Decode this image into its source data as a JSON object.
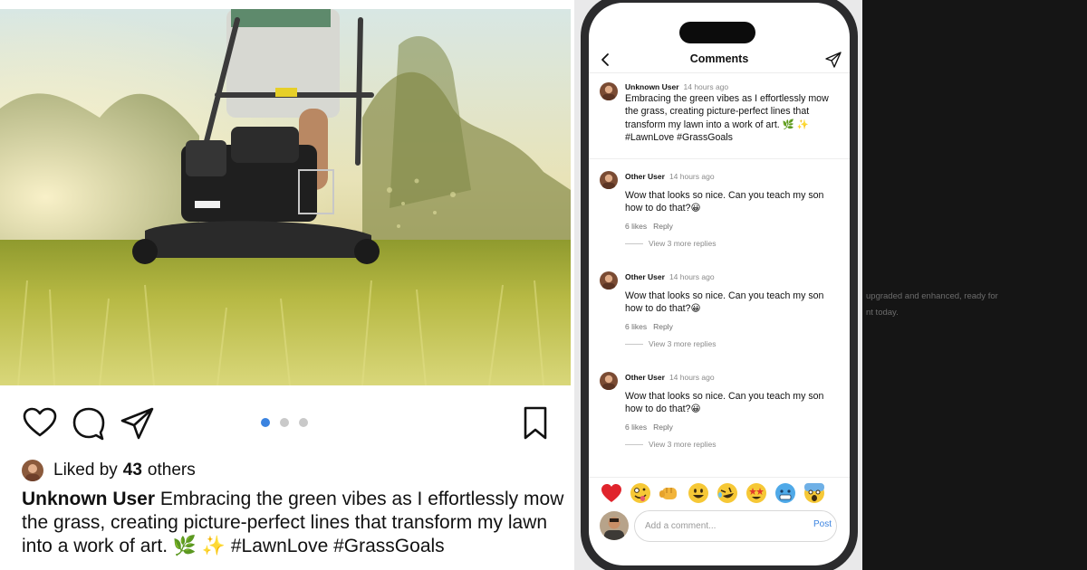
{
  "post": {
    "photo": {
      "description_icon": "lawn-mower-photo"
    },
    "actions": {
      "like_icon": "heart-icon",
      "comment_icon": "speech-bubble-icon",
      "share_icon": "paper-plane-icon",
      "save_icon": "bookmark-icon"
    },
    "carousel": {
      "count": 3,
      "active_index": 0
    },
    "likes": {
      "prefix": "Liked by",
      "count": "43",
      "suffix": "others"
    },
    "caption": {
      "user": "Unknown User",
      "text": "Embracing the green vibes as I effortlessly mow the grass, creating picture-perfect lines that transform my lawn into a work of art. 🌿 ✨ #LawnLove #GrassGoals"
    }
  },
  "phone": {
    "header": {
      "title": "Comments",
      "back_icon": "chevron-left-icon",
      "send_icon": "paper-plane-icon"
    },
    "original": {
      "user": "Unknown User",
      "time": "14 hours ago",
      "text": "Embracing the green vibes as I effortlessly mow the grass, creating picture-perfect lines that transform my lawn into a work of art. 🌿 ✨ #LawnLove #GrassGoals"
    },
    "comments": [
      {
        "user": "Other User",
        "time": "14 hours ago",
        "text": "Wow that looks so nice. Can you teach my son how to do that?😀",
        "likes": "6 likes",
        "reply": "Reply",
        "more": "View 3 more replies"
      },
      {
        "user": "Other User",
        "time": "14 hours ago",
        "text": "Wow that looks so nice. Can you teach my son how to do that?😀",
        "likes": "6 likes",
        "reply": "Reply",
        "more": "View 3 more replies"
      },
      {
        "user": "Other User",
        "time": "14 hours ago",
        "text": "Wow that looks so nice. Can you teach my son how to do that?😀",
        "likes": "6 likes",
        "reply": "Reply",
        "more": "View 3 more replies"
      }
    ],
    "emoji_bar": [
      "red-heart",
      "zany-face",
      "fist",
      "smiley",
      "rofl",
      "star-struck",
      "cold-face",
      "scream-face"
    ],
    "composer": {
      "placeholder": "Add a comment...",
      "post_label": "Post"
    }
  },
  "dark_panel": {
    "line1": "upgraded and enhanced, ready for",
    "line2": "nt today."
  },
  "colors": {
    "accent": "#3a83e0",
    "dot_inactive": "#c9c9c9",
    "dark_panel": "#151515"
  }
}
